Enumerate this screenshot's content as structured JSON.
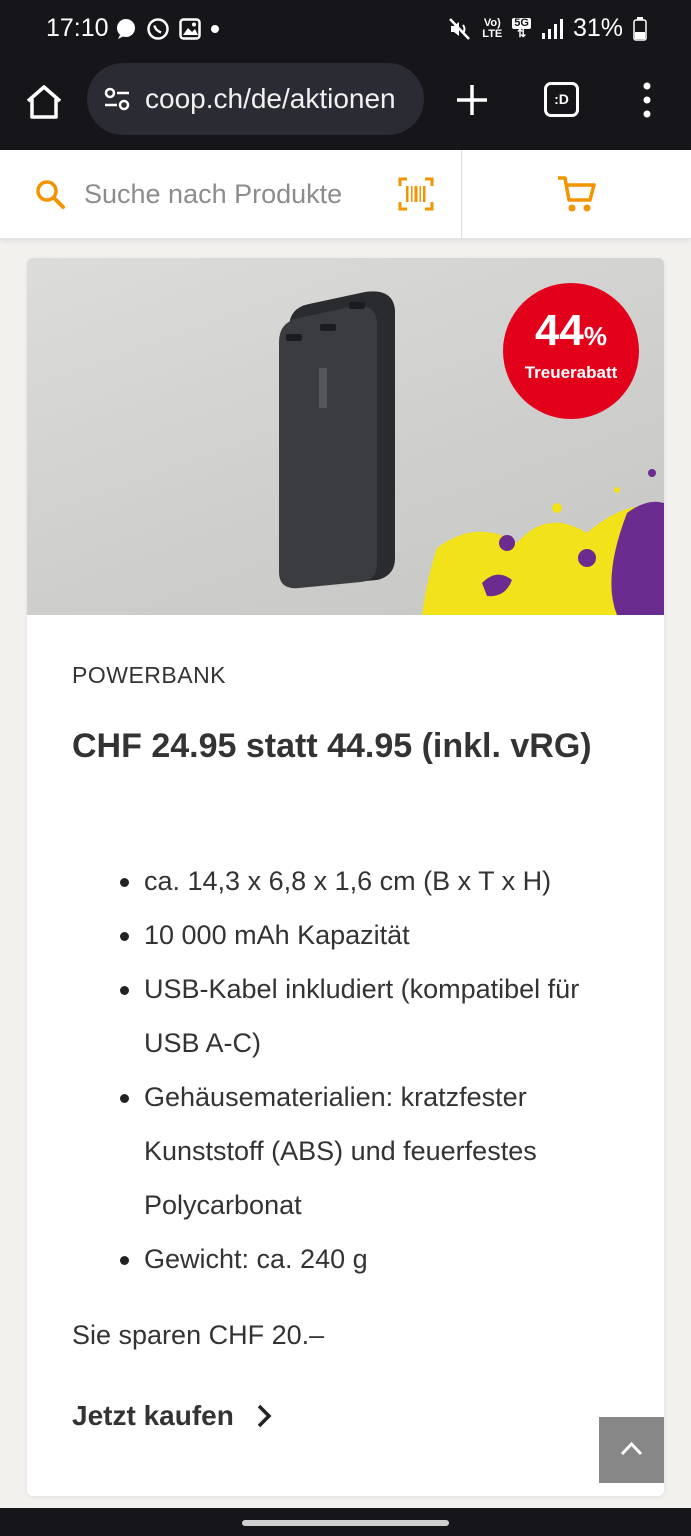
{
  "status_bar": {
    "time": "17:10",
    "battery": "31%",
    "network_top": "Vo)",
    "network_bottom": "LTE",
    "network_5g": "5G"
  },
  "browser": {
    "url": "coop.ch/de/aktionen",
    "tabs_label": ":D"
  },
  "header": {
    "search_placeholder": "Suche nach Produkte"
  },
  "product": {
    "discount_value": "44",
    "discount_unit": "%",
    "discount_label": "Treuerabatt",
    "category": "POWERBANK",
    "price": "CHF 24.95 statt 44.95 (inkl. vRG)",
    "features": [
      "ca. 14,3 x 6,8 x 1,6 cm (B x T x H)",
      "10 000 mAh Kapazität",
      "USB-Kabel inkludiert (kompatibel für USB A-C)",
      "Gehäusematerialien: kratzfester Kunststoff (ABS) und feuerfestes Polycarbonat",
      "Gewicht: ca. 240 g"
    ],
    "savings": "Sie sparen CHF 20.–",
    "buy_label": "Jetzt kaufen"
  },
  "colors": {
    "accent_orange": "#f29400",
    "badge_red": "#e3001b",
    "browser_dark": "#16161a"
  }
}
